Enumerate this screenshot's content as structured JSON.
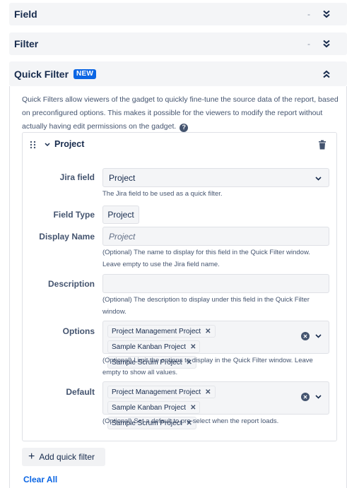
{
  "sections": {
    "field": {
      "title": "Field",
      "dash": "-"
    },
    "filter": {
      "title": "Filter",
      "dash": "-"
    },
    "quick_filter": {
      "title": "Quick Filter",
      "badge": "NEW"
    }
  },
  "intro_text": "Quick Filters allow viewers of the gadget to quickly fine-tune the source data of the report, based on preconfigured options. This makes it possible for the viewers to modify the report without actually having edit permissions on the gadget.",
  "card": {
    "title": "Project",
    "jira_field": {
      "label": "Jira field",
      "value": "Project",
      "help": "The Jira field to be used as a quick filter."
    },
    "field_type": {
      "label": "Field Type",
      "value": "Project"
    },
    "display_name": {
      "label": "Display Name",
      "placeholder": "Project",
      "help": "(Optional) The name to display for this field in the Quick Filter window. Leave empty to use the Jira field name."
    },
    "description": {
      "label": "Description",
      "value": "",
      "help": "(Optional) The description to display under this field in the Quick Filter window."
    },
    "options": {
      "label": "Options",
      "tags": [
        "Project Management Project",
        "Sample Kanban Project",
        "Sample Scrum Project"
      ],
      "help": "(Optional) Limit the options to display in the Quick Filter window. Leave empty to show all values."
    },
    "default": {
      "label": "Default",
      "tags": [
        "Project Management Project",
        "Sample Kanban Project",
        "Sample Scrum Project"
      ],
      "help": "(Optional) Set a default to pre-select when the report loads."
    }
  },
  "add_quick_filter_label": "Add quick filter",
  "clear_all_label": "Clear All",
  "icons": {
    "expand": "double-chevron-down-icon",
    "collapse": "double-chevron-up-icon",
    "drag": "drag-handle-icon",
    "trash": "trash-icon",
    "help": "question-circle-icon",
    "clear": "clear-circle-icon",
    "remove": "remove-x-icon"
  },
  "colors": {
    "accent": "#0c66e4",
    "header_bg": "#f4f5f7",
    "text": "#172b4d",
    "muted": "#44546f"
  }
}
